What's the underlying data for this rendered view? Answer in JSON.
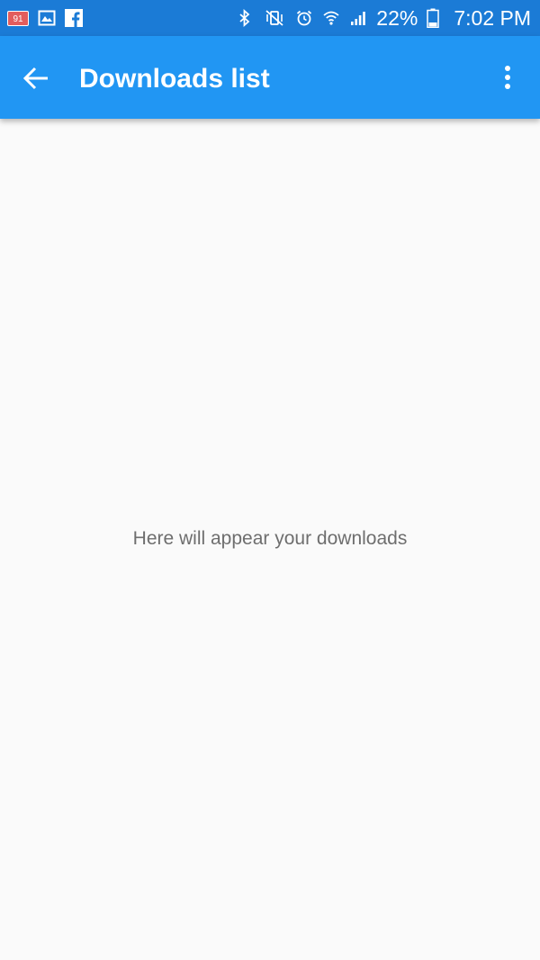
{
  "status_bar": {
    "notification_count": "91",
    "battery_percent": "22%",
    "time": "7:02 PM",
    "background_color": "#1b7bd6",
    "left_icons": [
      "messages-icon",
      "gallery-icon",
      "facebook-icon"
    ],
    "right_icons": [
      "bluetooth-icon",
      "vibrate-mute-icon",
      "alarm-icon",
      "wifi-icon",
      "signal-icon",
      "battery-icon"
    ]
  },
  "app_bar": {
    "title": "Downloads list",
    "background_color": "#2196f3",
    "back_icon": "arrow-back-icon",
    "menu_icon": "more-vert-icon"
  },
  "content": {
    "empty_message": "Here will appear your downloads",
    "background_color": "#fafafa"
  }
}
